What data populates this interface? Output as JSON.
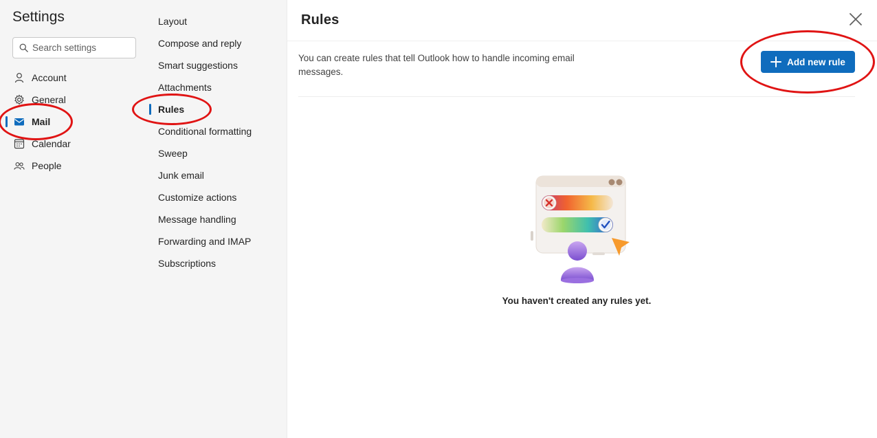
{
  "settings": {
    "title": "Settings",
    "search_placeholder": "Search settings"
  },
  "nav": {
    "items": [
      {
        "label": "Account",
        "icon": "person-icon"
      },
      {
        "label": "General",
        "icon": "gear-icon"
      },
      {
        "label": "Mail",
        "icon": "mail-icon",
        "active": true
      },
      {
        "label": "Calendar",
        "icon": "calendar-icon"
      },
      {
        "label": "People",
        "icon": "people-icon"
      }
    ]
  },
  "mail_menu": {
    "items": [
      "Layout",
      "Compose and reply",
      "Smart suggestions",
      "Attachments",
      "Rules",
      "Conditional formatting",
      "Sweep",
      "Junk email",
      "Customize actions",
      "Message handling",
      "Forwarding and IMAP",
      "Subscriptions"
    ],
    "active": "Rules"
  },
  "rules": {
    "title": "Rules",
    "description": "You can create rules that tell Outlook how to handle incoming email messages.",
    "add_button": "Add new rule",
    "empty_message": "You haven't created any rules yet."
  },
  "colors": {
    "accent": "#0f6cbd",
    "annotation": "#e01414"
  }
}
